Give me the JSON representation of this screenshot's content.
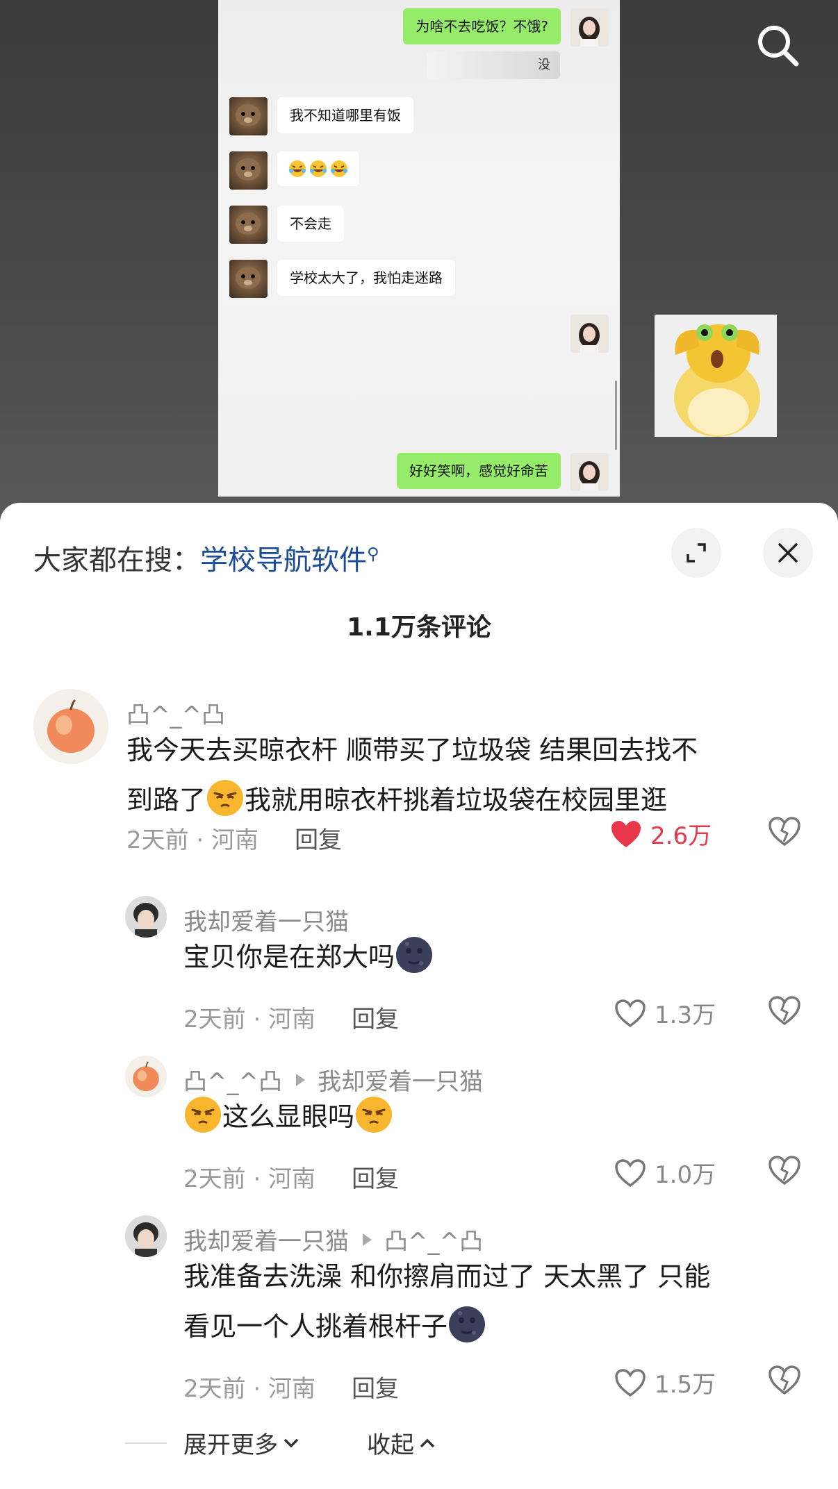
{
  "chat": {
    "messages": [
      {
        "text": "为啥不去吃饭？不饿?"
      },
      {
        "text": "没"
      },
      {
        "text": "我不知道哪里有饭"
      },
      {
        "text": "不会走"
      },
      {
        "text": "学校太大了，我怕走迷路"
      },
      {
        "text": "好好笑啊，感觉好命苦"
      }
    ]
  },
  "sheet": {
    "hot_search_prefix": "大家都在搜：",
    "hot_search_keyword": "学校导航软件",
    "comment_count": "1.1万条评论"
  },
  "comments": [
    {
      "user": "凸^_^凸",
      "line1": "我今天去买晾衣杆 顺带买了垃圾袋 结果回去找不",
      "line2_a": "到路了",
      "line2_b": "我就用晾衣杆挑着垃圾袋在校园里逛",
      "time": "2天前 · 河南",
      "reply": "回复",
      "likes": "2.6万"
    },
    {
      "user": "我却爱着一只猫",
      "text": "宝贝你是在郑大吗",
      "time": "2天前 · 河南",
      "reply": "回复",
      "likes": "1.3万"
    },
    {
      "user": "凸^_^凸",
      "reply_to": "我却爱着一只猫",
      "text": "这么显眼吗",
      "time": "2天前 · 河南",
      "reply": "回复",
      "likes": "1.0万"
    },
    {
      "user": "我却爱着一只猫",
      "reply_to": "凸^_^凸",
      "line1": "我准备去洗澡 和你擦肩而过了 天太黑了 只能",
      "line2": "看见一个人挑着根杆子",
      "time": "2天前 · 河南",
      "reply": "回复",
      "likes": "1.5万"
    }
  ],
  "footer": {
    "expand_more": "展开更多",
    "collapse": "收起"
  },
  "colors": {
    "like_active": "#e8374b",
    "wechat_green": "#95ec69",
    "keyword_blue": "#1d4c97"
  }
}
